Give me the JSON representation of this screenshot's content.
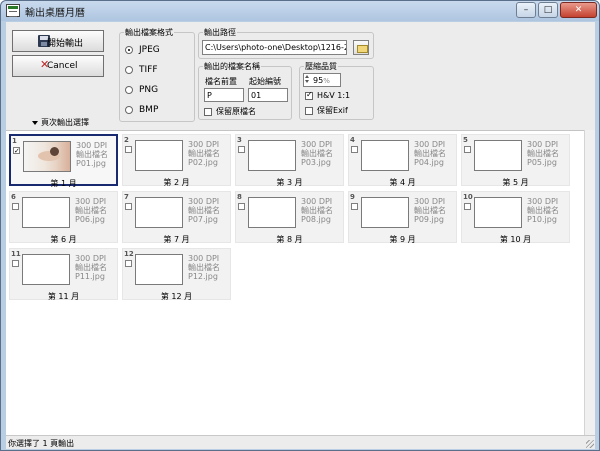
{
  "window": {
    "title": "輸出桌曆月曆"
  },
  "caption_buttons": {
    "minimize": "–",
    "maximize": "□",
    "close": "✕"
  },
  "actions": {
    "start_label": "開始輸出",
    "cancel_label": "Cancel",
    "options_toggle_label": "頁次輸出選擇"
  },
  "format_group": {
    "title": "輸出檔案格式",
    "options": [
      {
        "label": "JPEG",
        "selected": true
      },
      {
        "label": "TIFF",
        "selected": false
      },
      {
        "label": "PNG",
        "selected": false
      },
      {
        "label": "BMP",
        "selected": false
      }
    ]
  },
  "path_group": {
    "title": "輸出路徑",
    "value": "C:\\Users\\photo-one\\Desktop\\1216-2"
  },
  "name_group": {
    "title": "輸出的檔案名稱",
    "prefix_label": "檔名前置",
    "prefix_value": "P",
    "start_label": "起始編號",
    "start_value": "01",
    "keep_original_label": "保留原檔名",
    "keep_original_checked": false
  },
  "quality_group": {
    "title": "壓縮品質",
    "quality_value": "95",
    "quality_unit": "%",
    "hv_label": "H&V 1:1",
    "hv_checked": true,
    "exif_label": "保留Exif",
    "exif_checked": false
  },
  "pages": [
    {
      "num": "1",
      "dpi": "300 DPI",
      "title": "輸出檔名",
      "file": "P01.jpg",
      "label": "第 1 月",
      "checked": true,
      "selected": true,
      "thumb": "photo"
    },
    {
      "num": "2",
      "dpi": "300 DPI",
      "title": "輸出檔名",
      "file": "P02.jpg",
      "label": "第 2 月",
      "checked": false,
      "selected": false,
      "thumb": "blank"
    },
    {
      "num": "3",
      "dpi": "300 DPI",
      "title": "輸出檔名",
      "file": "P03.jpg",
      "label": "第 3 月",
      "checked": false,
      "selected": false,
      "thumb": "blank"
    },
    {
      "num": "4",
      "dpi": "300 DPI",
      "title": "輸出檔名",
      "file": "P04.jpg",
      "label": "第 4 月",
      "checked": false,
      "selected": false,
      "thumb": "blank"
    },
    {
      "num": "5",
      "dpi": "300 DPI",
      "title": "輸出檔名",
      "file": "P05.jpg",
      "label": "第 5 月",
      "checked": false,
      "selected": false,
      "thumb": "blank"
    },
    {
      "num": "6",
      "dpi": "300 DPI",
      "title": "輸出檔名",
      "file": "P06.jpg",
      "label": "第 6 月",
      "checked": false,
      "selected": false,
      "thumb": "blank"
    },
    {
      "num": "7",
      "dpi": "300 DPI",
      "title": "輸出檔名",
      "file": "P07.jpg",
      "label": "第 7 月",
      "checked": false,
      "selected": false,
      "thumb": "blank"
    },
    {
      "num": "8",
      "dpi": "300 DPI",
      "title": "輸出檔名",
      "file": "P08.jpg",
      "label": "第 8 月",
      "checked": false,
      "selected": false,
      "thumb": "blank"
    },
    {
      "num": "9",
      "dpi": "300 DPI",
      "title": "輸出檔名",
      "file": "P09.jpg",
      "label": "第 9 月",
      "checked": false,
      "selected": false,
      "thumb": "blank"
    },
    {
      "num": "10",
      "dpi": "300 DPI",
      "title": "輸出檔名",
      "file": "P10.jpg",
      "label": "第 10 月",
      "checked": false,
      "selected": false,
      "thumb": "blank"
    },
    {
      "num": "11",
      "dpi": "300 DPI",
      "title": "輸出檔名",
      "file": "P11.jpg",
      "label": "第 11 月",
      "checked": false,
      "selected": false,
      "thumb": "blank"
    },
    {
      "num": "12",
      "dpi": "300 DPI",
      "title": "輸出檔名",
      "file": "P12.jpg",
      "label": "第 12 月",
      "checked": false,
      "selected": false,
      "thumb": "blank"
    }
  ],
  "status": {
    "text": "你選擇了 1 頁輸出"
  }
}
